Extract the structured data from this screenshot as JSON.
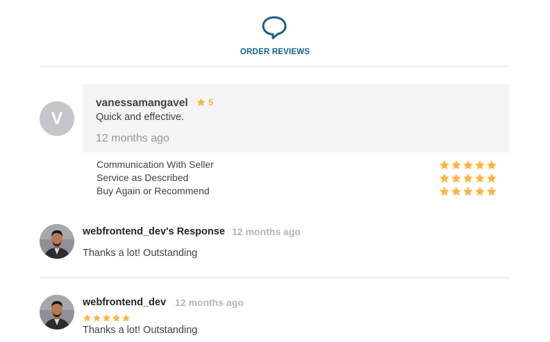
{
  "header": {
    "title": "ORDER REVIEWS",
    "icon": "chat-bubble-icon",
    "color": "#1a5d84"
  },
  "review": {
    "avatar_letter": "V",
    "username": "vanessamangavel",
    "rating": "5",
    "comment": "Quick and effective.",
    "time": "12 months ago",
    "breakdown": [
      {
        "label": "Communication With Seller",
        "stars": 5
      },
      {
        "label": "Service as Described",
        "stars": 5
      },
      {
        "label": "Buy Again or Recommend",
        "stars": 5
      }
    ]
  },
  "seller_response": {
    "name": "webfrontend_dev's Response",
    "time": "12 months ago",
    "text": "Thanks a lot! Outstanding"
  },
  "seller_review": {
    "name": "webfrontend_dev",
    "time": "12 months ago",
    "stars": 5,
    "text": "Thanks a lot! Outstanding"
  },
  "colors": {
    "star": "#ffb33e",
    "accent": "#1a5d84"
  }
}
